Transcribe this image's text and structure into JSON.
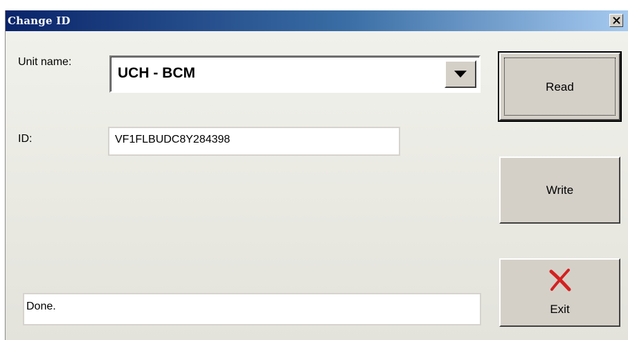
{
  "window": {
    "title": "Change ID"
  },
  "form": {
    "unit_name_label": "Unit name:",
    "unit_name_value": "UCH - BCM",
    "id_label": "ID:",
    "id_value": "VF1FLBUDC8Y284398",
    "status_text": "Done."
  },
  "buttons": {
    "read_label": "Read",
    "write_label": "Write",
    "exit_label": "Exit"
  },
  "icons": {
    "close": "close-icon",
    "dropdown": "chevron-down-icon",
    "exit": "red-x-icon"
  },
  "colors": {
    "titlebar_start": "#0a246a",
    "titlebar_end": "#a6caf0",
    "exit_icon": "#d42020"
  }
}
